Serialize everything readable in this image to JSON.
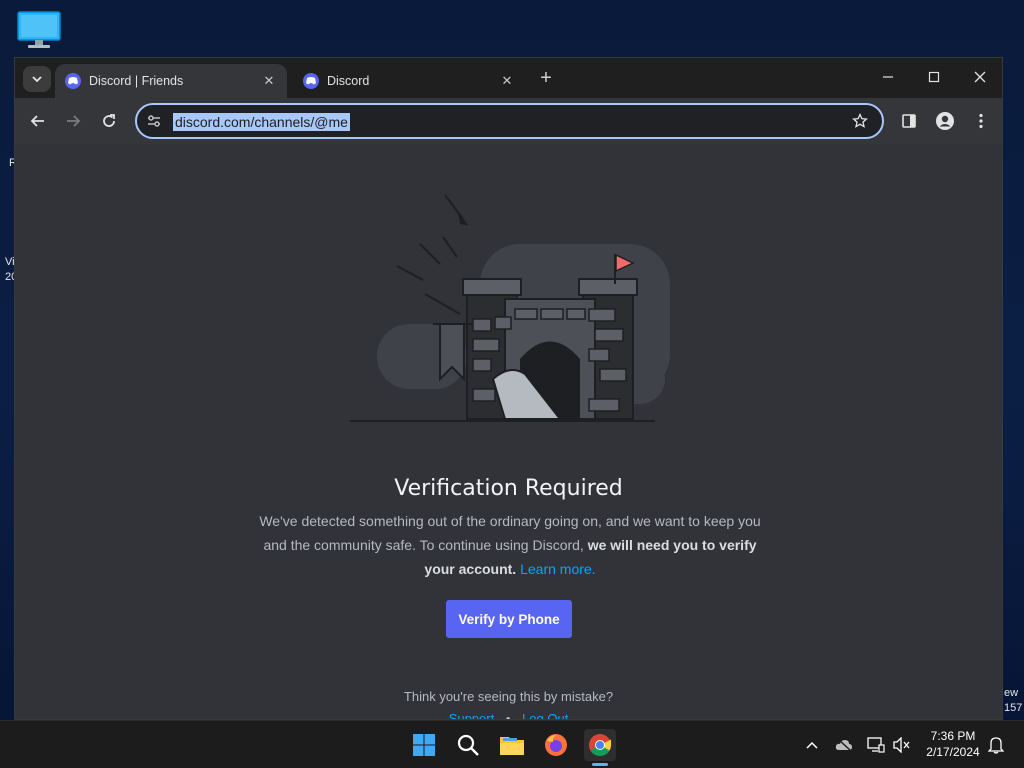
{
  "desktop": {
    "label_r": "R",
    "label_vi": "Vi",
    "label_20": "20",
    "label_ew": "ew",
    "label_157": "157"
  },
  "tabs": [
    {
      "title": "Discord | Friends",
      "active": true
    },
    {
      "title": "Discord",
      "active": false
    }
  ],
  "toolbar": {
    "url": "discord.com/channels/@me"
  },
  "page": {
    "title": "Verification Required",
    "desc_part1": "We've detected something out of the ordinary going on, and we want to keep you and the community safe. To continue using Discord,",
    "desc_bold": "we will need you to verify your account.",
    "desc_link": "Learn more.",
    "verify_button": "Verify by Phone",
    "mistake_text": "Think you're seeing this by mistake?",
    "support_link": "Support",
    "separator": "•",
    "logout_link": "Log Out"
  },
  "taskbar": {
    "time": "7:36 PM",
    "date": "2/17/2024"
  },
  "colors": {
    "discord_blurple": "#5865f2",
    "link_blue": "#00a8fc",
    "page_bg": "#313338"
  }
}
